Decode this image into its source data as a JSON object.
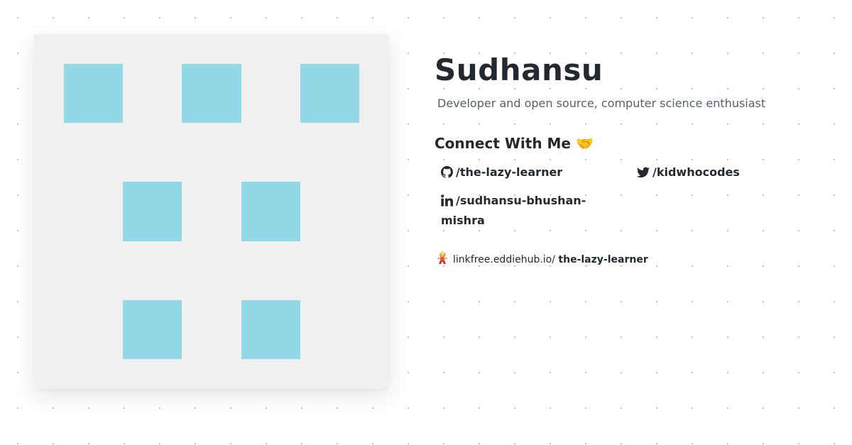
{
  "colors": {
    "avatar_background": "#f0f0f0",
    "avatar_block": "#92d8e6",
    "text_primary": "#24292f",
    "text_secondary": "#57606a"
  },
  "avatar": {
    "pattern": [
      [
        1,
        0,
        1,
        0,
        1
      ],
      [
        0,
        0,
        0,
        0,
        0
      ],
      [
        0,
        1,
        0,
        1,
        0
      ],
      [
        0,
        0,
        0,
        0,
        0
      ],
      [
        0,
        1,
        0,
        1,
        0
      ]
    ]
  },
  "profile": {
    "name": "Sudhansu",
    "bio": "Developer and open source, computer science enthusiast"
  },
  "connect": {
    "heading": "Connect With Me",
    "heading_emoji": "🤝",
    "links": {
      "github": {
        "icon": "github-icon",
        "label": "/the-lazy-learner"
      },
      "twitter": {
        "icon": "twitter-icon",
        "label": "/kidwhocodes"
      },
      "linkedin": {
        "icon": "linkedin-icon",
        "label": "/sudhansu-bhushan-mishra"
      }
    }
  },
  "linkfree": {
    "icon": "linkfree-icon",
    "prefix": "linkfree.eddiehub.io/",
    "username": "the-lazy-learner"
  }
}
